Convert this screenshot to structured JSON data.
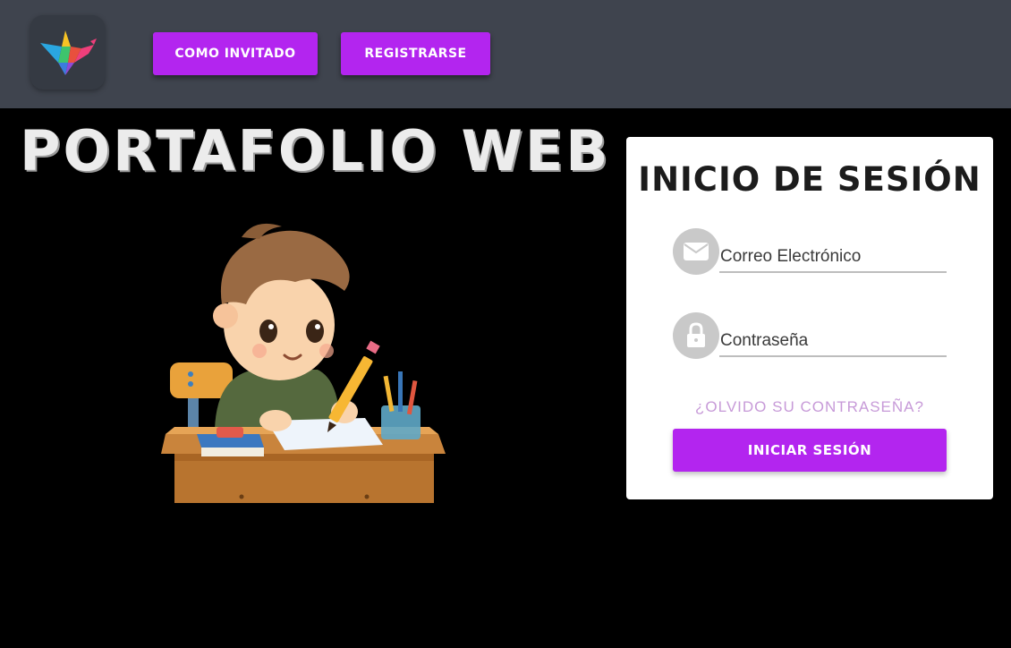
{
  "header": {
    "logo_icon": "origami-crane-icon",
    "guest_button": "COMO INVITADO",
    "register_button": "REGISTRARSE"
  },
  "hero": {
    "title": "PORTAFOLIO WEB",
    "illustration": "child-writing-at-desk"
  },
  "login": {
    "title": "INICIO DE SESIÓN",
    "email_icon": "envelope-icon",
    "email_placeholder": "Correo Electrónico",
    "password_icon": "lock-icon",
    "password_placeholder": "Contraseña",
    "forgot_link": "¿OLVIDO SU CONTRASEÑA?",
    "submit_button": "INICIAR SESIÓN"
  },
  "colors": {
    "header_bg": "#3f444e",
    "accent": "#b325ef",
    "page_bg": "#000000",
    "card_bg": "#ffffff"
  }
}
